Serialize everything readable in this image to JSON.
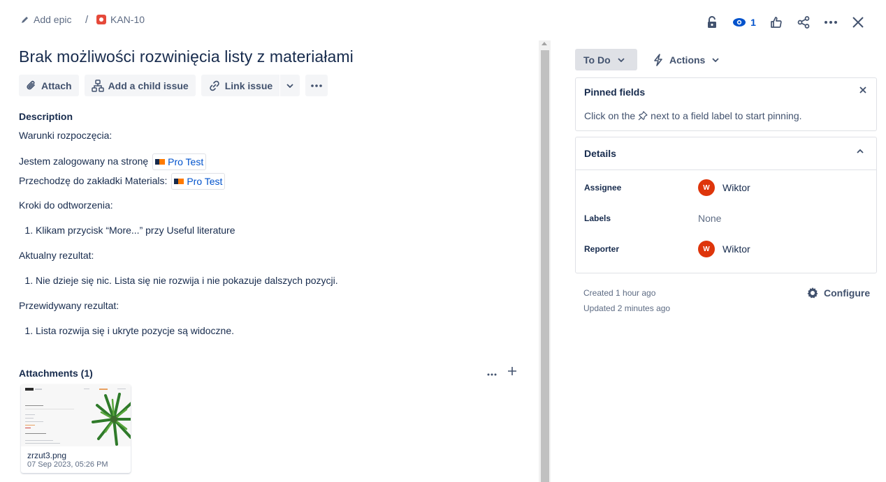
{
  "breadcrumb": {
    "epic_label": "Add epic",
    "separator": "/",
    "issue_key": "KAN-10"
  },
  "header": {
    "watch_count": "1"
  },
  "issue": {
    "title": "Brak możliwości rozwinięcia listy z materiałami"
  },
  "toolbar": {
    "attach_label": "Attach",
    "child_label": "Add a child issue",
    "link_label": "Link issue"
  },
  "description": {
    "heading": "Description",
    "line1": "Warunki rozpoczęcia:",
    "line2_text": "Jestem zalogowany na stronę",
    "line2_link": "Pro Test",
    "line3_text": "Przechodzę do zakładki Materials:",
    "line3_link": "Pro Test",
    "steps_heading": "Kroki do odtworzenia:",
    "step1": "Klikam przycisk “More...” przy Useful literature",
    "actual_heading": "Aktualny rezultat:",
    "actual1": "Nie dzieje się nic. Lista się nie rozwija i nie pokazuje dalszych pozycji.",
    "expected_heading": "Przewidywany rezultat:",
    "expected1": "Lista rozwija się i ukryte pozycje są widoczne."
  },
  "attachments": {
    "heading": "Attachments (1)",
    "file_name": "zrzut3.png",
    "file_date": "07 Sep 2023, 05:26 PM"
  },
  "status": {
    "label": "To Do",
    "actions_label": "Actions"
  },
  "pinned": {
    "heading": "Pinned fields",
    "text_before": "Click on the",
    "text_after": "next to a field label to start pinning."
  },
  "details": {
    "heading": "Details",
    "assignee_label": "Assignee",
    "assignee_initial": "W",
    "assignee_name": "Wiktor",
    "labels_label": "Labels",
    "labels_value": "None",
    "reporter_label": "Reporter",
    "reporter_initial": "W",
    "reporter_name": "Wiktor"
  },
  "meta": {
    "created": "Created 1 hour ago",
    "updated": "Updated 2 minutes ago",
    "configure_label": "Configure"
  },
  "colors": {
    "link": "#0052cc",
    "text": "#172b4d",
    "avatar": "#de350b",
    "bug_icon": "#e5493a"
  }
}
